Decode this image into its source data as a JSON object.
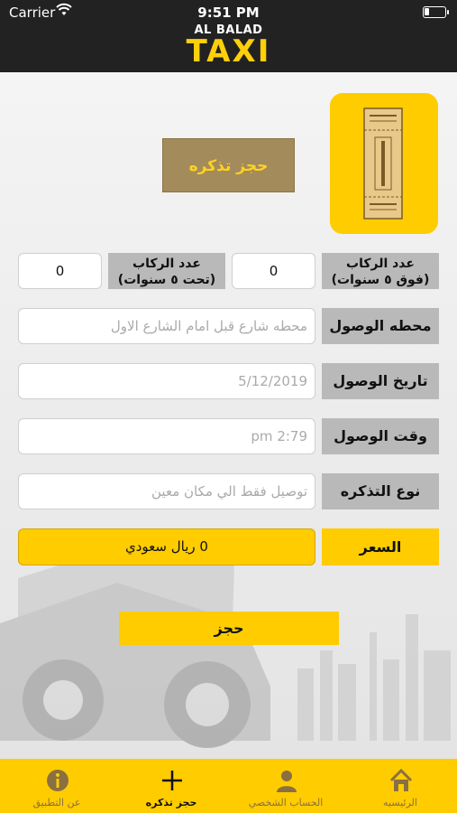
{
  "status_bar": {
    "carrier": "Carrier",
    "time": "9:51 PM"
  },
  "header": {
    "logo_top": "AL BALAD",
    "logo_main": "TAXI"
  },
  "ticket": {
    "book_ticket_button": "حجز تذكره"
  },
  "passengers": {
    "adults_label_line1": "عدد الركاب",
    "adults_label_line2": "(فوق ٥ سنوات)",
    "adults_value": "0",
    "children_label_line1": "عدد الركاب",
    "children_label_line2": "(تحت ٥ سنوات)",
    "children_value": "0"
  },
  "form": {
    "arrival_station_label": "محطه الوصول",
    "arrival_station_placeholder": "محطه شارع قبل امام الشارع الاول",
    "arrival_date_label": "تاريخ الوصول",
    "arrival_date_placeholder": "5/12/2019",
    "arrival_time_label": "وقت الوصول",
    "arrival_time_placeholder": "2:79 pm",
    "ticket_type_label": "نوع التذكره",
    "ticket_type_placeholder": "توصيل فقط الي مكان معين",
    "price_label": "السعر",
    "price_value": "0 ريال سعودي"
  },
  "book_button": "حجز",
  "tabs": [
    {
      "label": "الرئيسيه",
      "icon": "home-icon"
    },
    {
      "label": "الحساب الشخصي",
      "icon": "user-icon"
    },
    {
      "label": "حجز تذكره",
      "icon": "plus-icon"
    },
    {
      "label": "عن التطبيق",
      "icon": "info-icon"
    }
  ],
  "colors": {
    "accent": "#ffcc00",
    "header_bg": "#222222",
    "button_brown": "#a48b5c",
    "label_gray": "#b9b9b9"
  }
}
